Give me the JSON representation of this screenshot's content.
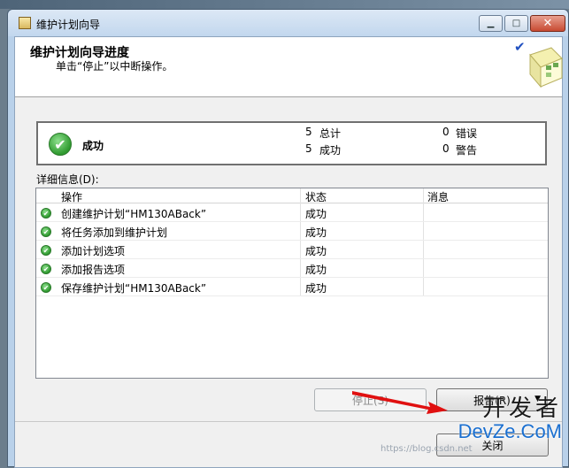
{
  "window": {
    "title": "维护计划向导",
    "min_glyph": "▁",
    "max_glyph": "□",
    "close_glyph": "✕"
  },
  "header": {
    "title": "维护计划向导进度",
    "subtitle": "单击“停止”以中断操作。",
    "check_glyph": "✔"
  },
  "summary": {
    "label": "成功",
    "success_glyph": "✔",
    "total_count": "5",
    "total_label": "总计",
    "success_count": "5",
    "success_label": "成功",
    "error_count": "0",
    "error_label": "错误",
    "warning_count": "0",
    "warning_label": "警告"
  },
  "details": {
    "label": "详细信息(D):",
    "columns": [
      "操作",
      "状态",
      "消息"
    ],
    "rows": [
      {
        "operation": "创建维护计划“HM130ABack”",
        "status": "成功",
        "message": ""
      },
      {
        "operation": "将任务添加到维护计划",
        "status": "成功",
        "message": ""
      },
      {
        "operation": "添加计划选项",
        "status": "成功",
        "message": ""
      },
      {
        "operation": "添加报告选项",
        "status": "成功",
        "message": ""
      },
      {
        "operation": "保存维护计划“HM130ABack”",
        "status": "成功",
        "message": ""
      }
    ]
  },
  "buttons": {
    "stop": "停止(S)",
    "report": "报告(R)",
    "report_arrow": "▼",
    "close": "关闭"
  },
  "watermark": {
    "cn": "开发者",
    "en": "DevZe.CoM",
    "url": "https://blog.csdn.net"
  },
  "colors": {
    "success_green": "#2f9a2f",
    "arrow_red": "#e01010",
    "window_frame": "#b9d1ea"
  }
}
